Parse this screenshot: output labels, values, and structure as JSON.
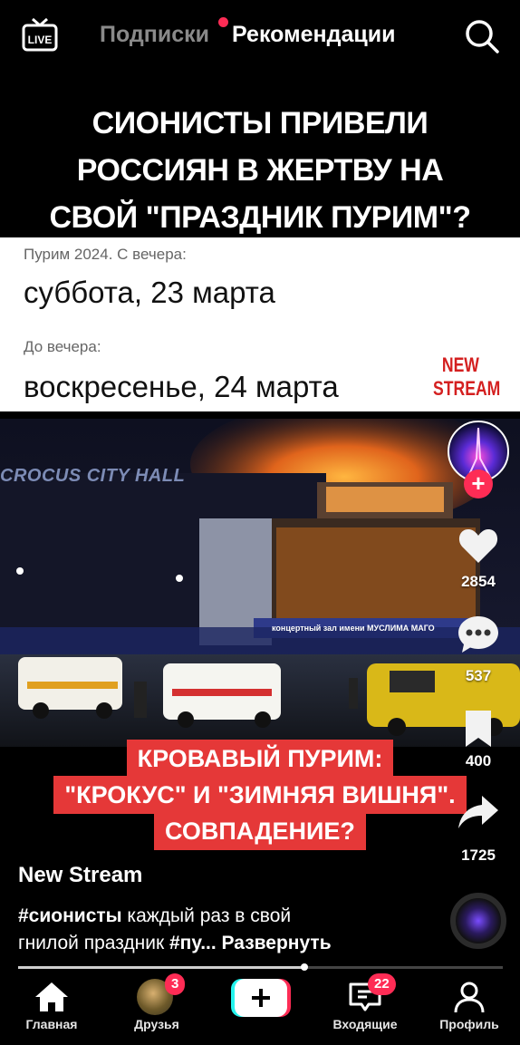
{
  "header": {
    "live_icon": "live-tv-icon",
    "tabs": [
      {
        "label": "Подписки",
        "active": false,
        "has_dot": true
      },
      {
        "label": "Рекомендации",
        "active": true
      }
    ],
    "search_icon": "search-icon"
  },
  "video": {
    "headline_lines": [
      "СИОНИСТЫ ПРИВЕЛИ",
      "РОССИЯН В ЖЕРТВУ НА",
      "СВОЙ \"ПРАЗДНИК ПУРИМ\"?"
    ],
    "info": {
      "label1": "Пурим 2024. С вечера:",
      "date1": "суббота, 23 марта",
      "label2": "До вечера:",
      "date2": "воскресенье, 24 марта",
      "stamp_line1": "NEW",
      "stamp_line2": "STREAM"
    },
    "photo": {
      "sign_text": "CROCUS CITY HALL",
      "banner_text": "концертный зал имени МУСЛИМА МАГО"
    },
    "caption_lines": [
      "КРОВАВЫЙ ПУРИМ:",
      "\"КРОКУС\" И \"ЗИМНЯЯ ВИШНЯ\".",
      "СОВПАДЕНИЕ?"
    ]
  },
  "rail": {
    "likes": "2854",
    "comments": "537",
    "saves": "400",
    "shares": "1725"
  },
  "post": {
    "author": "New Stream",
    "hashtag1": "#сионисты",
    "text1": " каждый раз в свой",
    "text2": "гнилой праздник ",
    "hashtag2": "#пу...",
    "expand": "Развернуть",
    "progress_fraction": 0.59
  },
  "nav": {
    "home": "Главная",
    "friends": "Друзья",
    "friends_badge": "3",
    "inbox": "Входящие",
    "inbox_badge": "22",
    "profile": "Профиль"
  },
  "colors": {
    "accent": "#fe2c55",
    "caption_red": "#e53838",
    "stamp_red": "#d42020"
  }
}
